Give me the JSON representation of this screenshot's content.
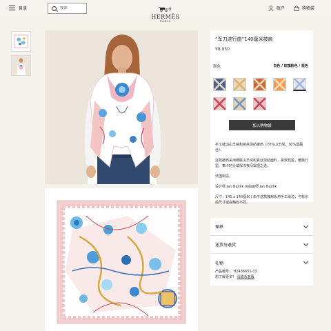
{
  "header": {
    "menu_label": "目录",
    "search_placeholder": "搜索",
    "logo_name": "HERMÈS",
    "logo_city": "PARIS",
    "account_label": "账户",
    "bag_label": "购物袋"
  },
  "product": {
    "title": "“军刀进行曲”140厘米披肩",
    "price": "¥8,950",
    "color_label": "颜色",
    "color_value": "白色 / 玫瑰粉色 / 蓝色",
    "add_to_bag": "加入购物袋",
    "description": [
      "手工缝边山羊绒和真丝混纺披肩（70%山羊绒，30%桑蚕丝）。",
      "这款披肩采用细腻山羊绒和真丝混纺面料，柔软轻盈，暖融万里。奉冷时分或探冻夜间需理之选。",
      "法国制造。",
      "设计师 Jan Bajtlik 白由画师 Jan Bajtlik",
      "尺寸：140 x 140厘米 | 由于这款披肩采用手工缝边，与标示的尺寸或会略有不同。"
    ]
  },
  "accordion": [
    {
      "label": "保养"
    },
    {
      "label": "送货与退货"
    },
    {
      "label": "礼物"
    }
  ],
  "reference": {
    "code_label": "产品编号：",
    "code": "H243665S 03",
    "question": "想了解更多？",
    "contact": "请联系客服"
  },
  "colors": {
    "background": "#f5f1eb",
    "button": "#3a3a3a",
    "scarf_pink": "#f2c9c7",
    "scarf_blue": "#4a9fd6"
  }
}
